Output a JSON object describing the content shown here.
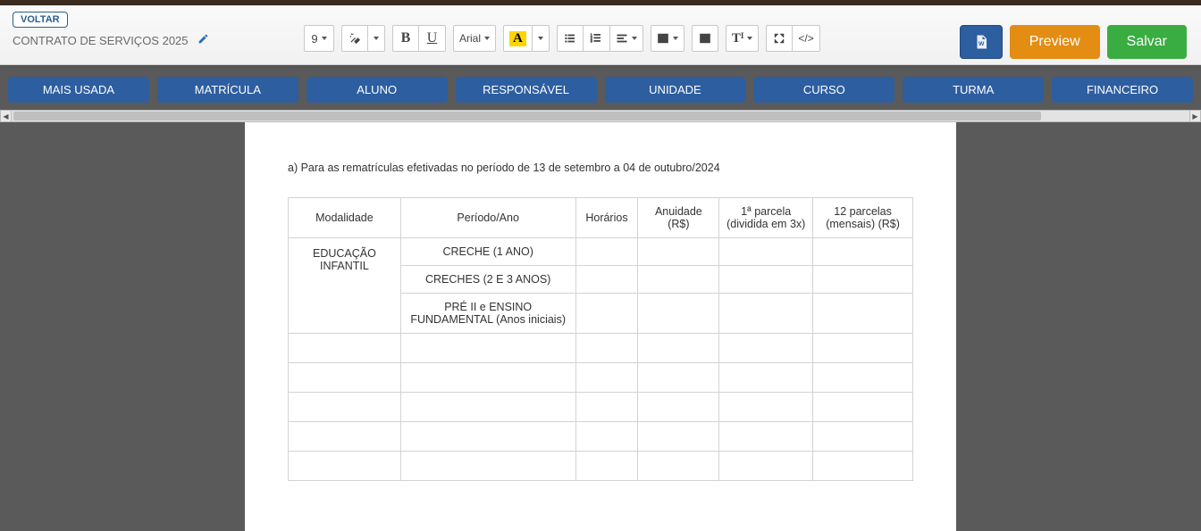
{
  "meta": {
    "back_label": "VOLTAR",
    "doc_title": "CONTRATO DE SERVIÇOS 2025"
  },
  "toolbar": {
    "font_size": "9",
    "font_name": "Arial",
    "highlight_char": "A"
  },
  "actions": {
    "preview": "Preview",
    "save": "Salvar"
  },
  "tabs": [
    "MAIS USADA",
    "MATRÍCULA",
    "ALUNO",
    "RESPONSÁVEL",
    "UNIDADE",
    "CURSO",
    "TURMA",
    "FINANCEIRO"
  ],
  "document": {
    "line1": "a) Para as rematrículas efetivadas no período de 13 de setembro a 04 de outubro/2024",
    "table": {
      "headers": [
        "Modalidade",
        "Período/Ano",
        "Horários",
        "Anuidade (R$)",
        "1ª parcela (dividida em 3x)",
        "12 parcelas (mensais) (R$)"
      ],
      "rows": [
        {
          "modalidade": "EDUCAÇÃO INFANTIL",
          "periodos": [
            "CRECHE (1 ANO)",
            "CRECHES (2 E 3 ANOS)",
            "PRÉ II e ENSINO FUNDAMENTAL (Anos iniciais)"
          ]
        }
      ]
    }
  }
}
